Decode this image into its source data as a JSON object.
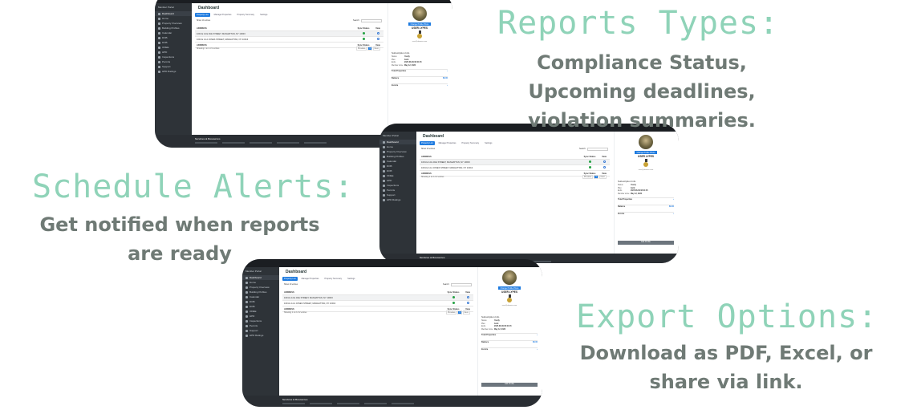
{
  "captions": {
    "reports": {
      "title": "Reports Types:",
      "body": "Compliance Status, Upcoming deadlines, violation summaries."
    },
    "alerts": {
      "title": "Schedule Alerts:",
      "body": "Get notified when reports are ready"
    },
    "export": {
      "title": "Export Options:",
      "body": "Download as PDF, Excel, or share via link."
    }
  },
  "app": {
    "brand": "Member Portal",
    "sidebar": [
      {
        "label": "Dashboard",
        "active": true
      },
      {
        "label": "Home"
      },
      {
        "label": "Property Overview"
      },
      {
        "label": "Building Profiles"
      },
      {
        "label": "Calendar"
      },
      {
        "label": "DOB"
      },
      {
        "label": "DOB"
      },
      {
        "label": "ODEE"
      },
      {
        "label": "HPD"
      },
      {
        "label": "Inspections"
      },
      {
        "label": "Permits"
      },
      {
        "label": "Support"
      },
      {
        "label": "HPD Ratings"
      }
    ],
    "page_title": "Dashboard",
    "tabs": [
      "Property List",
      "Manage Properties",
      "Property Summary",
      "Settings"
    ],
    "show_label": "Show 10 entries",
    "search_label": "Search:",
    "table": {
      "headers": [
        "ADDRESS",
        "Sync Status",
        "View"
      ],
      "rows": [
        "1001 E 14 E AVE STREET, MANHATTAN, NY 10003",
        "1001 E 14 A JONES STREET, MANHATTAN, NY 10013"
      ],
      "footer": [
        "ADDRESS",
        "Sync Status",
        "View"
      ]
    },
    "showing": "Showing 1 to 2 of 2 entries",
    "pager": [
      "Previous",
      "1",
      "Next"
    ],
    "profile": {
      "change_button": "Change Profile Photo",
      "username": "USER LYPES",
      "email": "user@domain.com",
      "subscription_title": "Subscription Info",
      "fields": [
        {
          "k": "Status",
          "v": "Yearly"
        },
        {
          "k": "Plan",
          "v": "Gold"
        },
        {
          "k": "Ends",
          "v": "2025-08-09 08:21:45"
        },
        {
          "k": "Member since",
          "v": "May 12, 2020"
        }
      ],
      "sections": [
        "Total Properties",
        "Balance",
        "Invoice"
      ],
      "balance_value": "$0.00",
      "edit_button": "Edit Profile"
    },
    "footer_title": "Services & Resources"
  }
}
